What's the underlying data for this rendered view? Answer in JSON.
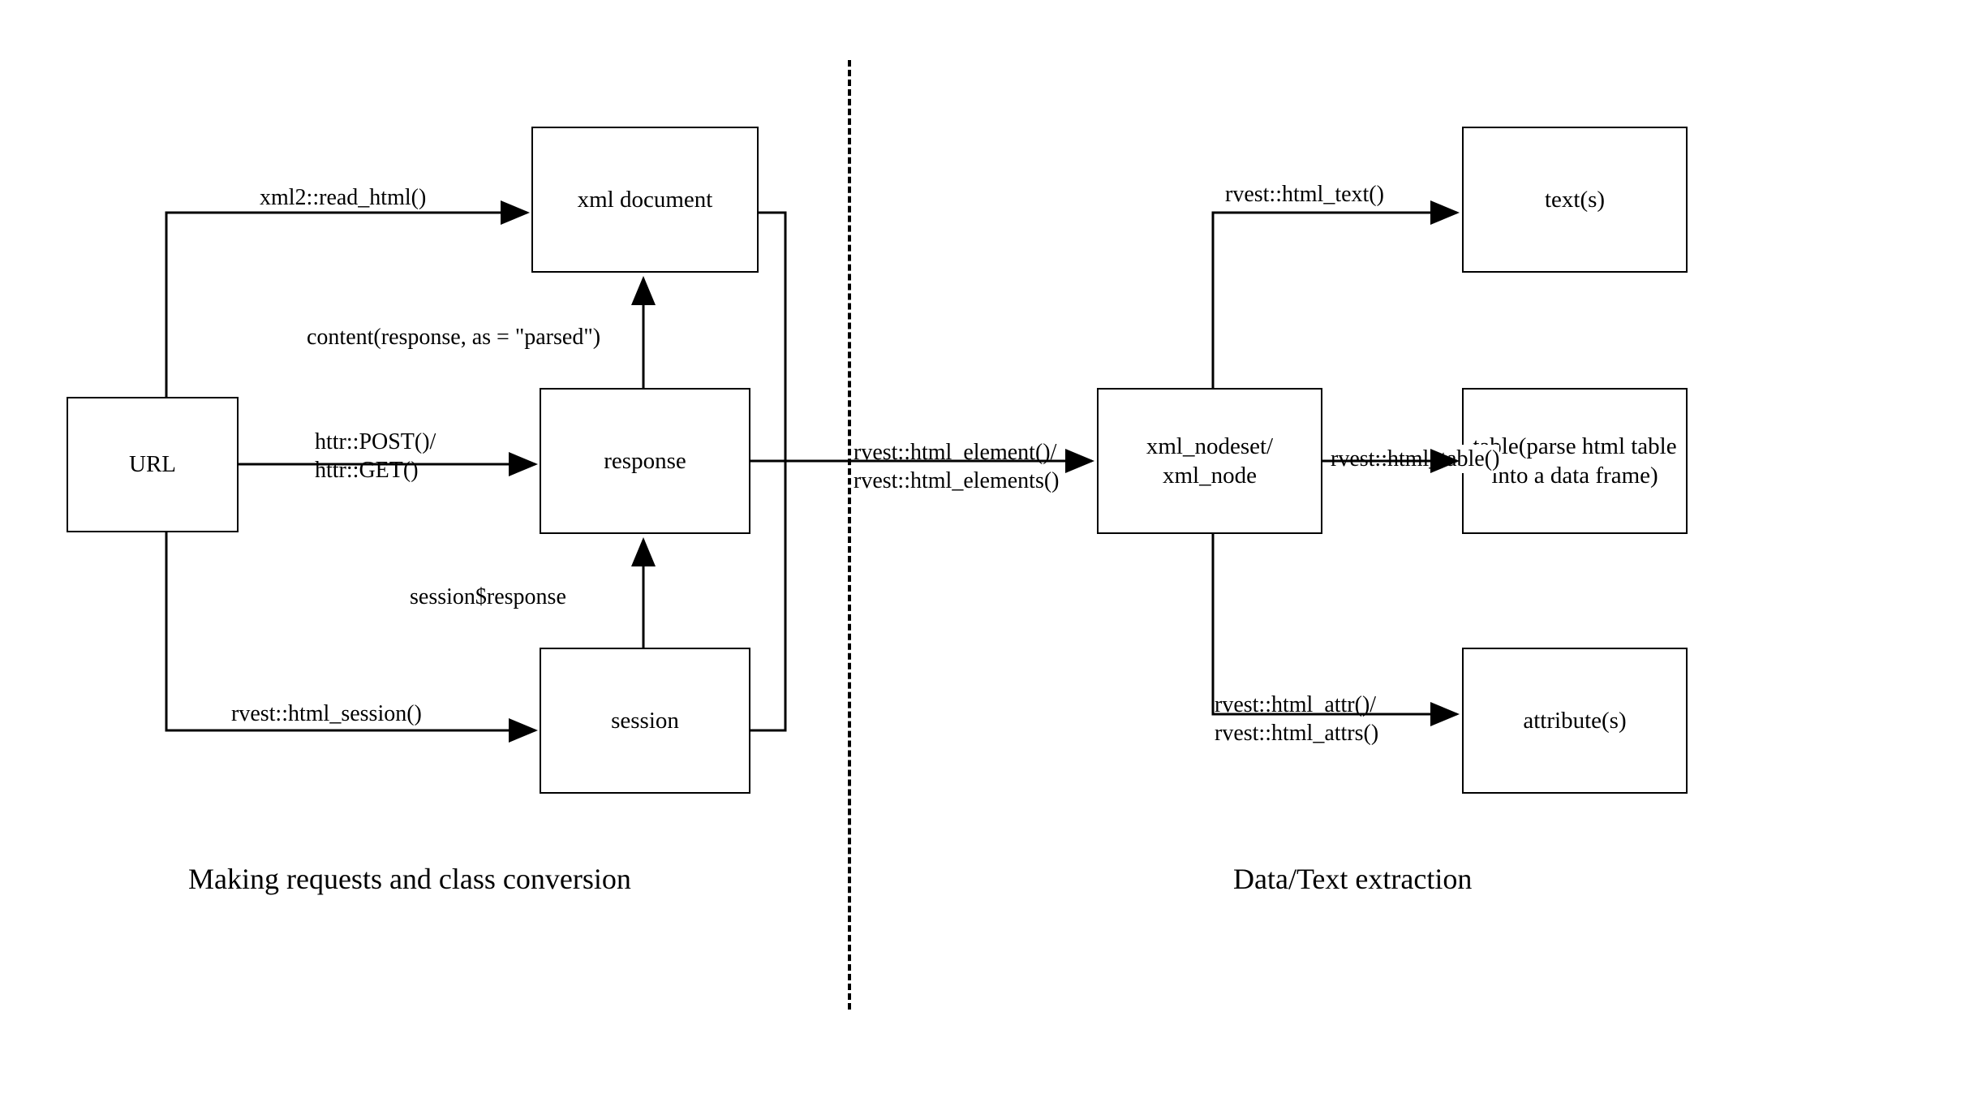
{
  "nodes": {
    "url": "URL",
    "xml_document": "xml document",
    "response": "response",
    "session": "session",
    "xml_nodeset": "xml_nodeset/\nxml_node",
    "text": "text(s)",
    "table": "table(parse html table into a data frame)",
    "attribute": "attribute(s)"
  },
  "edges": {
    "read_html": "xml2::read_html()",
    "httr": "httr::POST()/\nhttr::GET()",
    "html_session": "rvest::html_session()",
    "content_parsed": "content(response, as = \"parsed\")",
    "session_response": "session$response",
    "html_element": "rvest::html_element()/\nrvest::html_elements()",
    "html_text": "rvest::html_text()",
    "html_table": "rvest::html_table()",
    "html_attr": "rvest::html_attr()/\nrvest::html_attrs()"
  },
  "sections": {
    "left": "Making requests and class conversion",
    "right": "Data/Text extraction"
  }
}
